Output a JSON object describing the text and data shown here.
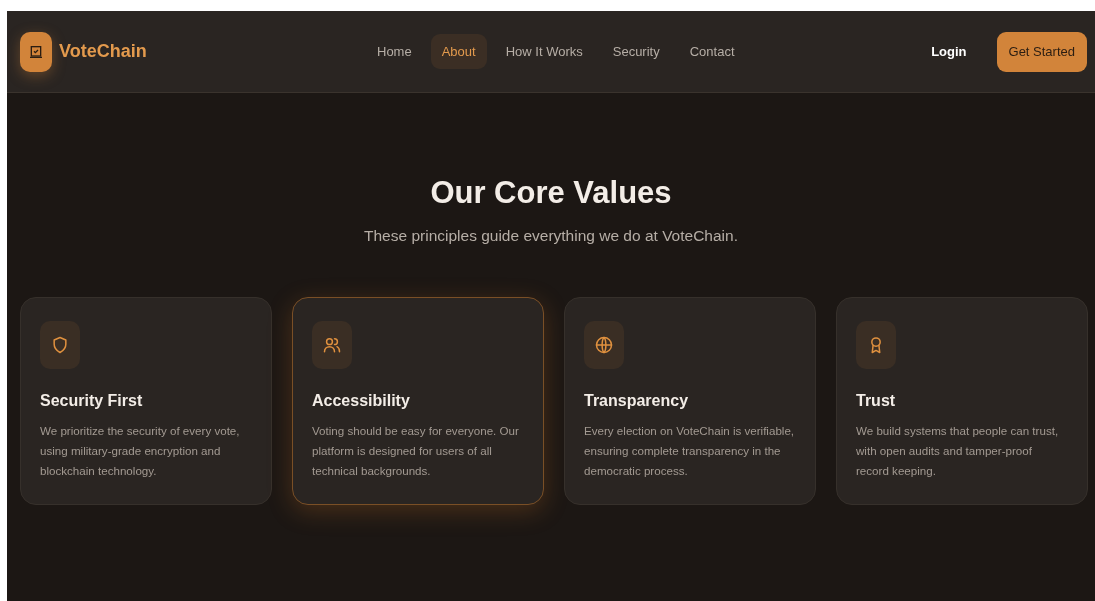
{
  "navbar": {
    "brand": "VoteChain",
    "links": [
      {
        "label": "Home",
        "selected": false
      },
      {
        "label": "About",
        "selected": true
      },
      {
        "label": "How It Works",
        "selected": false
      },
      {
        "label": "Security",
        "selected": false
      },
      {
        "label": "Contact",
        "selected": false
      }
    ],
    "login": "Login",
    "cta": "Get Started"
  },
  "section": {
    "title": "Our Core Values",
    "subtitle": "These principles guide everything we do at VoteChain."
  },
  "cards": [
    {
      "kind": "shield",
      "title": "Security First",
      "text": "We prioritize the security of every vote, using military-grade encryption and blockchain technology.",
      "highlighted": false
    },
    {
      "kind": "users",
      "title": "Accessibility",
      "text": "Voting should be easy for everyone. Our platform is designed for users of all technical backgrounds.",
      "highlighted": true
    },
    {
      "kind": "globe",
      "title": "Transparency",
      "text": "Every election on VoteChain is verifiable, ensuring complete transparency in the democratic process.",
      "highlighted": false
    },
    {
      "kind": "award",
      "title": "Trust",
      "text": "We build systems that people can trust, with open audits and tamper-proof record keeping.",
      "highlighted": false
    }
  ]
}
